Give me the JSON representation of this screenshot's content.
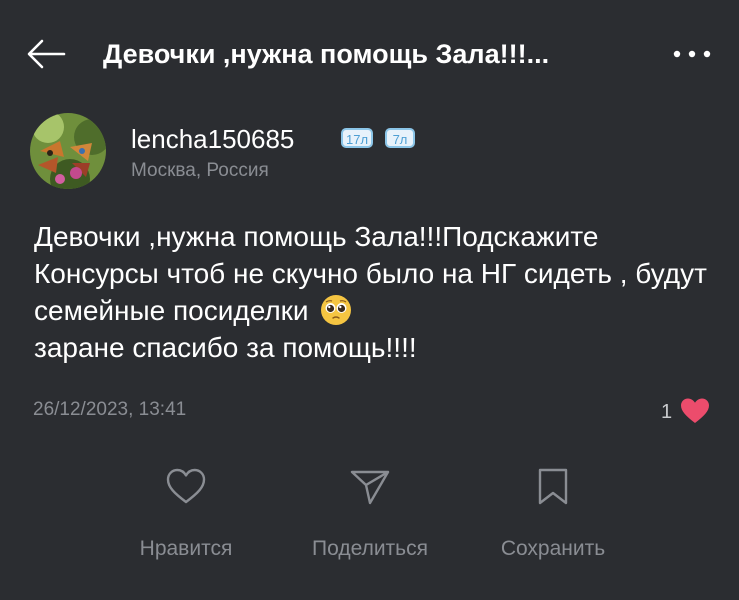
{
  "header": {
    "title": "Девочки ,нужна помощь Зала!!!..."
  },
  "author": {
    "username": "lencha150685",
    "badges": [
      "17л",
      "7л"
    ],
    "location": "Москва, Россия"
  },
  "post": {
    "text": "Девочки ,нужна помощь Зала!!!Подскажите Консурсы чтоб не скучно было на НГ сидеть , будут семейные посиделки",
    "text_end": "заране спасибо за помощь!!!!",
    "date": "26/12/2023, 13:41",
    "like_count": "1"
  },
  "actions": {
    "like": "Нравится",
    "share": "Поделиться",
    "save": "Сохранить"
  },
  "colors": {
    "background": "#2b2d31",
    "secondary_text": "#8a8d93",
    "heart": "#ec4c6c"
  }
}
